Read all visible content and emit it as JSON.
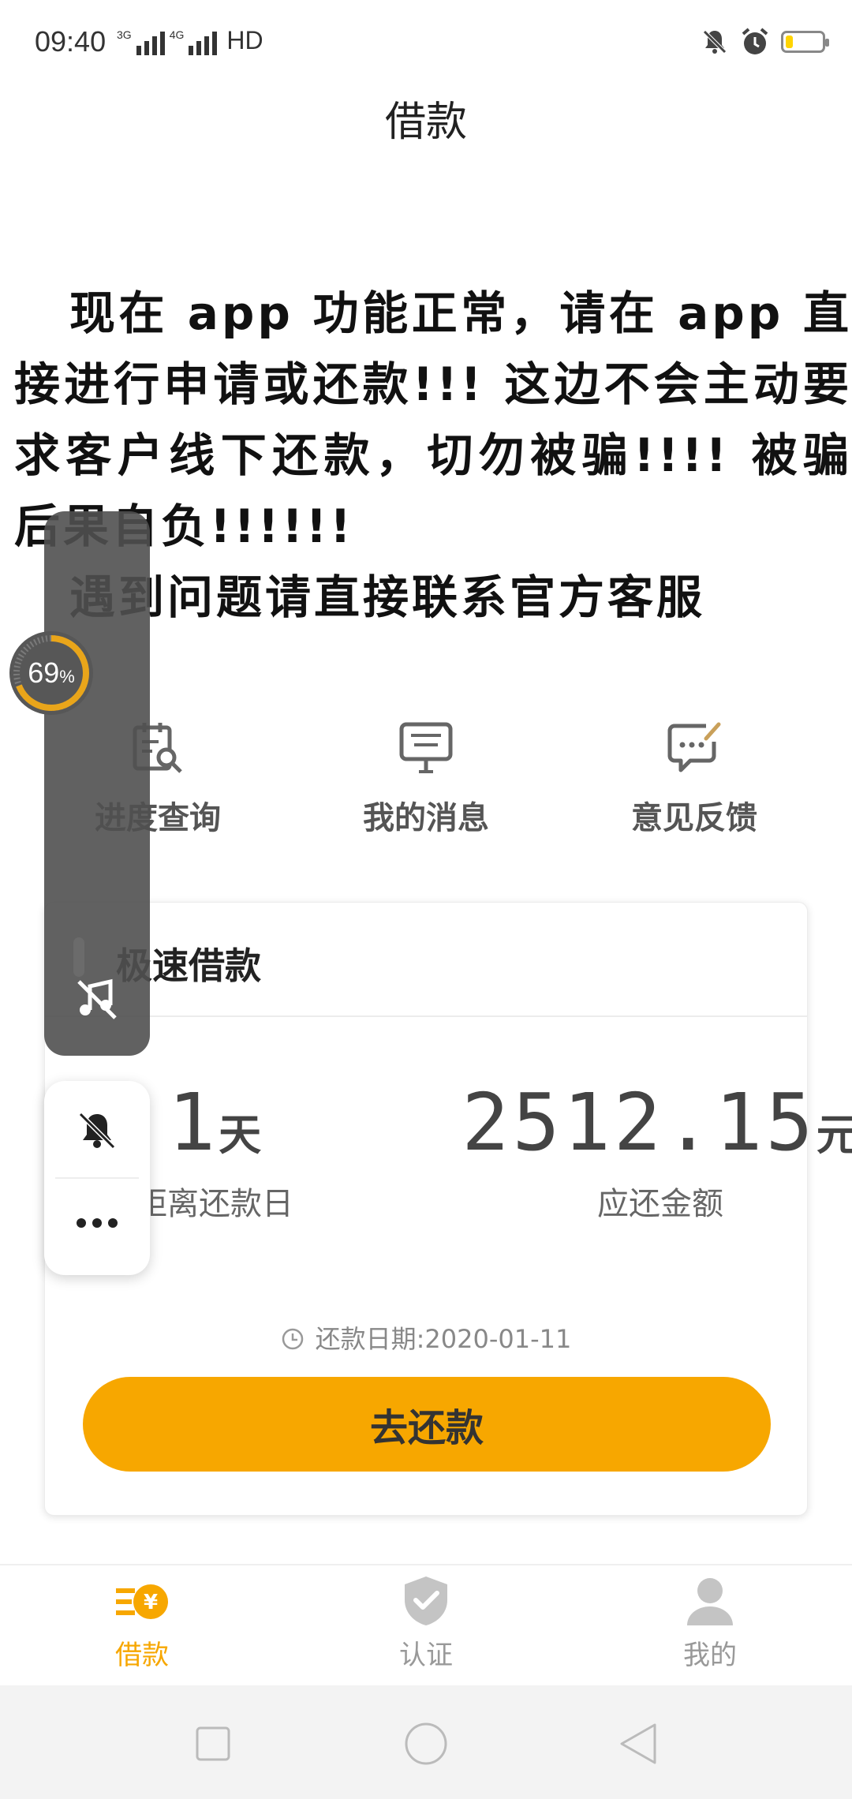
{
  "status_bar": {
    "time": "09:40",
    "network_1": "3G",
    "network_2": "4G",
    "hd": "HD",
    "icons": [
      "silent-bell-icon",
      "alarm-clock-icon",
      "battery-icon"
    ],
    "battery_level": 0.2,
    "battery_color": "#ffd400"
  },
  "header": {
    "title": "借款"
  },
  "notice": {
    "line1": "现在 app 功能正常，请在 app 直接进行申请或还款!!! 这边不会主动要求客户线下还款，切勿被骗!!!! 被骗后果自负!!!!!!",
    "line2": "遇到问题请直接联系官方客服"
  },
  "quick_menu": [
    {
      "label": "进度查询",
      "icon": "progress-search-icon"
    },
    {
      "label": "我的消息",
      "icon": "message-icon"
    },
    {
      "label": "意见反馈",
      "icon": "feedback-icon"
    }
  ],
  "loan_card": {
    "title": "极速借款",
    "days_value": "1",
    "days_unit": "天",
    "days_label": "距离还款日",
    "amount_value": "2512.15",
    "amount_unit": "元",
    "amount_label": "应还金额",
    "due_date": "还款日期:2020-01-11",
    "repay_button": "去还款"
  },
  "floating_widget": {
    "percent": "69",
    "percent_sign": "%",
    "icons": [
      "music-off-icon",
      "bell-off-icon",
      "more-icon"
    ]
  },
  "bottom_nav": [
    {
      "label": "借款",
      "icon": "loan-yen-icon",
      "active": true
    },
    {
      "label": "认证",
      "icon": "shield-check-icon",
      "active": false
    },
    {
      "label": "我的",
      "icon": "user-icon",
      "active": false
    }
  ],
  "system_nav": [
    "recent-apps-icon",
    "home-icon",
    "back-icon"
  ],
  "colors": {
    "accent": "#f7a700",
    "nav_inactive": "#999999",
    "icon_gray": "#666666"
  }
}
